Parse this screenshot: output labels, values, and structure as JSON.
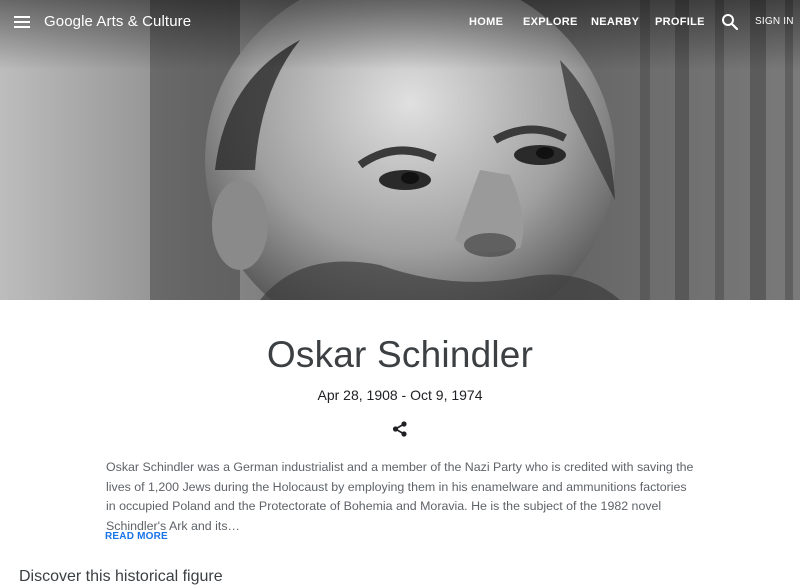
{
  "header": {
    "logo_text": "Google Arts & Culture",
    "nav": {
      "home": "HOME",
      "explore": "EXPLORE",
      "nearby": "NEARBY",
      "profile": "PROFILE"
    },
    "sign_in": "SIGN IN"
  },
  "icons": {
    "menu": "menu-icon",
    "search": "search-icon",
    "share": "share-icon"
  },
  "hero": {
    "image": "black-and-white portrait photo"
  },
  "profile": {
    "name": "Oskar Schindler",
    "dates": "Apr 28, 1908 - Oct 9, 1974",
    "description": "Oskar Schindler was a German industrialist and a member of the Nazi Party who is credited with saving the lives of 1,200 Jews during the Holocaust by employing them in his enamelware and ammunitions factories in occupied Poland and the Protectorate of Bohemia and Moravia. He is the subject of the 1982 novel Schindler's Ark and its…",
    "read_more": "READ MORE"
  },
  "sections": {
    "discover": "Discover this historical figure"
  },
  "colors": {
    "link": "#1a73e8",
    "title": "#3c4043",
    "body_text": "#5f6368"
  }
}
